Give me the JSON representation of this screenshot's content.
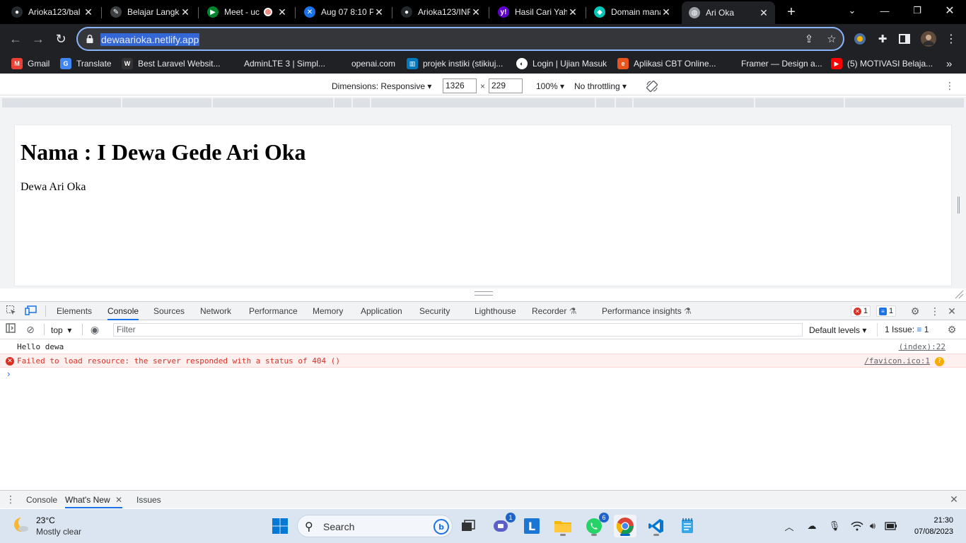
{
  "browser": {
    "tabs": [
      {
        "title": "Arioka123/bal",
        "favicon": "github-icon",
        "color": "#24292e",
        "glyph": "●"
      },
      {
        "title": "Belajar Langk",
        "favicon": "pen-icon",
        "color": "#3c4043",
        "glyph": "✎"
      },
      {
        "title": "Meet - uc",
        "favicon": "meet-icon",
        "color": "#00832d",
        "glyph": "▶",
        "recording": true
      },
      {
        "title": "Aug 07 8:10 P",
        "favicon": "app-icon",
        "color": "#1a73e8",
        "glyph": "✕"
      },
      {
        "title": "Arioka123/INF",
        "favicon": "github-icon",
        "color": "#24292e",
        "glyph": "●"
      },
      {
        "title": "Hasil Cari Yah",
        "favicon": "yahoo-icon",
        "color": "#6001d2",
        "glyph": "y!"
      },
      {
        "title": "Domain mana",
        "favicon": "netlify-icon",
        "color": "#00c7b7",
        "glyph": "◆"
      },
      {
        "title": "Ari Oka",
        "favicon": "globe-icon",
        "color": "#9aa0a6",
        "glyph": "◍",
        "active": true
      }
    ],
    "new_tab_label": "+",
    "url": "dewaarioka.netlify.app",
    "bookmarks": [
      {
        "label": "Gmail",
        "icon": "gmail-icon",
        "color": "#ea4335",
        "glyph": "M"
      },
      {
        "label": "Translate",
        "icon": "translate-icon",
        "color": "#4285f4",
        "glyph": "G"
      },
      {
        "label": "Best Laravel Websit...",
        "icon": "laravel-icon",
        "color": "#333333",
        "glyph": "W"
      },
      {
        "label": "AdminLTE 3 | Simpl...",
        "icon": "adminlte-icon",
        "color": "#202124",
        "glyph": ""
      },
      {
        "label": "openai.com",
        "icon": "openai-icon",
        "color": "#202124",
        "glyph": ""
      },
      {
        "label": "projek instiki (stikiuj...",
        "icon": "trello-icon",
        "color": "#0079bf",
        "glyph": "▥"
      },
      {
        "label": "Login | Ujian Masuk",
        "icon": "login-icon",
        "color": "#ffffff",
        "glyph": "◐"
      },
      {
        "label": "Aplikasi CBT Online...",
        "icon": "cbt-icon",
        "color": "#e8541e",
        "glyph": "e"
      },
      {
        "label": "Framer — Design a...",
        "icon": "framer-icon",
        "color": "#202124",
        "glyph": ""
      },
      {
        "label": "(5) MOTIVASI Belaja...",
        "icon": "youtube-icon",
        "color": "#ff0000",
        "glyph": "▶"
      }
    ],
    "bookmarks_more": "»"
  },
  "device_toolbar": {
    "dimensions_label": "Dimensions: Responsive",
    "width": "1326",
    "height": "229",
    "times": "×",
    "zoom": "100%",
    "throttling": "No throttling"
  },
  "page": {
    "heading": "Nama : I Dewa Gede Ari Oka",
    "paragraph": "Dewa Ari Oka"
  },
  "devtools": {
    "tabs": [
      "Elements",
      "Console",
      "Sources",
      "Network",
      "Performance",
      "Memory",
      "Application",
      "Security",
      "Lighthouse",
      "Recorder",
      "Performance insights"
    ],
    "active_tab": "Console",
    "error_count": "1",
    "message_count": "1",
    "context": "top",
    "filter_placeholder": "Filter",
    "levels": "Default levels",
    "issues_label": "1 Issue:",
    "issues_count": "1",
    "logs": [
      {
        "type": "log",
        "message": "Hello dewa",
        "source": "(index):22"
      },
      {
        "type": "error",
        "message": "Failed to load resource: the server responded with a status of 404 ()",
        "source": "/favicon.ico:1"
      }
    ],
    "prompt": "›",
    "drawer_tabs": [
      "Console",
      "What's New",
      "Issues"
    ],
    "drawer_active": "What's New"
  },
  "taskbar": {
    "temperature": "23°C",
    "condition": "Mostly clear",
    "search_label": "Search",
    "teams_badge": "1",
    "whatsapp_badge": "6",
    "time": "21:30",
    "date": "07/08/2023"
  },
  "colors": {
    "accent": "#1a73e8",
    "error": "#d93025",
    "chrome_dark": "#202124",
    "url_highlight": "#3367d6"
  }
}
